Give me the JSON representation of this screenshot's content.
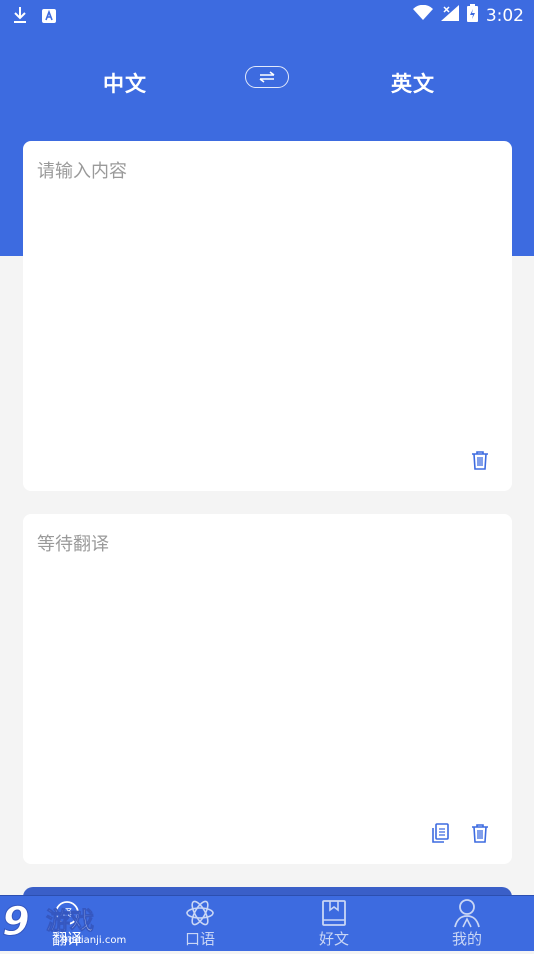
{
  "status_bar": {
    "time": "3:02"
  },
  "language_bar": {
    "source_lang": "中文",
    "target_lang": "英文"
  },
  "input_card": {
    "placeholder": "请输入内容"
  },
  "output_card": {
    "placeholder": "等待翻译"
  },
  "tabs": [
    {
      "label": "翻译",
      "icon": "translate-icon",
      "active": true
    },
    {
      "label": "口语",
      "icon": "atom-icon",
      "active": false
    },
    {
      "label": "好文",
      "icon": "bookmark-icon",
      "active": false
    },
    {
      "label": "我的",
      "icon": "profile-icon",
      "active": false
    }
  ],
  "watermark": {
    "text": "9游戏",
    "url": "9ddianji.com"
  },
  "colors": {
    "primary": "#3d6be0",
    "background": "#f4f4f4",
    "card": "#ffffff",
    "placeholder": "#9a9a9a",
    "icon": "#3d6be0"
  }
}
